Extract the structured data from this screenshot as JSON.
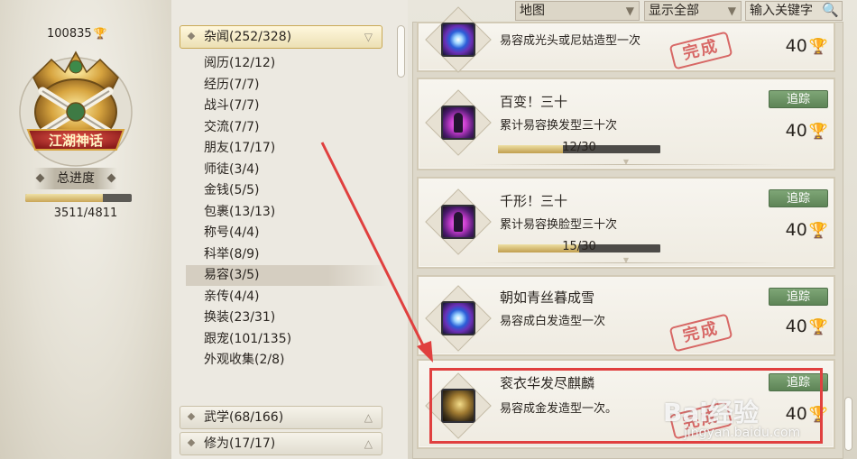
{
  "profile": {
    "points": "100835",
    "emblem_text": "江湖神话",
    "progress_label": "总进度",
    "progress_text": "3511/4811",
    "progress_fraction": 0.7296
  },
  "filters": {
    "map": "地图",
    "scope": "显示全部",
    "search_placeholder": "输入关键字"
  },
  "categories": [
    {
      "label": "杂闻(252/328)",
      "expanded": true
    },
    {
      "label": "武学(68/166)",
      "expanded": false
    },
    {
      "label": "修为(17/17)",
      "expanded": false
    }
  ],
  "subcategories": [
    "阅历(12/12)",
    "经历(7/7)",
    "战斗(7/7)",
    "交流(7/7)",
    "朋友(17/17)",
    "师徒(3/4)",
    "金钱(5/5)",
    "包裹(13/13)",
    "称号(4/4)",
    "科举(8/9)",
    "易容(3/5)",
    "亲传(4/4)",
    "换装(23/31)",
    "跟宠(101/135)",
    "外观收集(2/8)"
  ],
  "active_subcategory": "易容(3/5)",
  "achievements": [
    {
      "title": "",
      "desc": "易容成光头或尼姑造型一次",
      "reward": "40",
      "completed": true,
      "track_label": ""
    },
    {
      "title": "百变！三十",
      "desc": "累计易容换发型三十次",
      "reward": "40",
      "completed": false,
      "track_label": "追踪",
      "progress_text": "12/30",
      "progress_fraction": 0.4
    },
    {
      "title": "千形！三十",
      "desc": "累计易容换脸型三十次",
      "reward": "40",
      "completed": false,
      "track_label": "追踪",
      "progress_text": "15/30",
      "progress_fraction": 0.5
    },
    {
      "title": "朝如青丝暮成雪",
      "desc": "易容成白发造型一次",
      "reward": "40",
      "completed": true,
      "track_label": "追踪"
    },
    {
      "title": "衮衣华发尽麒麟",
      "desc": "易容成金发造型一次。",
      "reward": "40",
      "completed": true,
      "track_label": "追踪"
    }
  ],
  "stamp_text": "完成",
  "watermark": {
    "brand": "Bai经验",
    "url": "jingyan.baidu.com"
  }
}
